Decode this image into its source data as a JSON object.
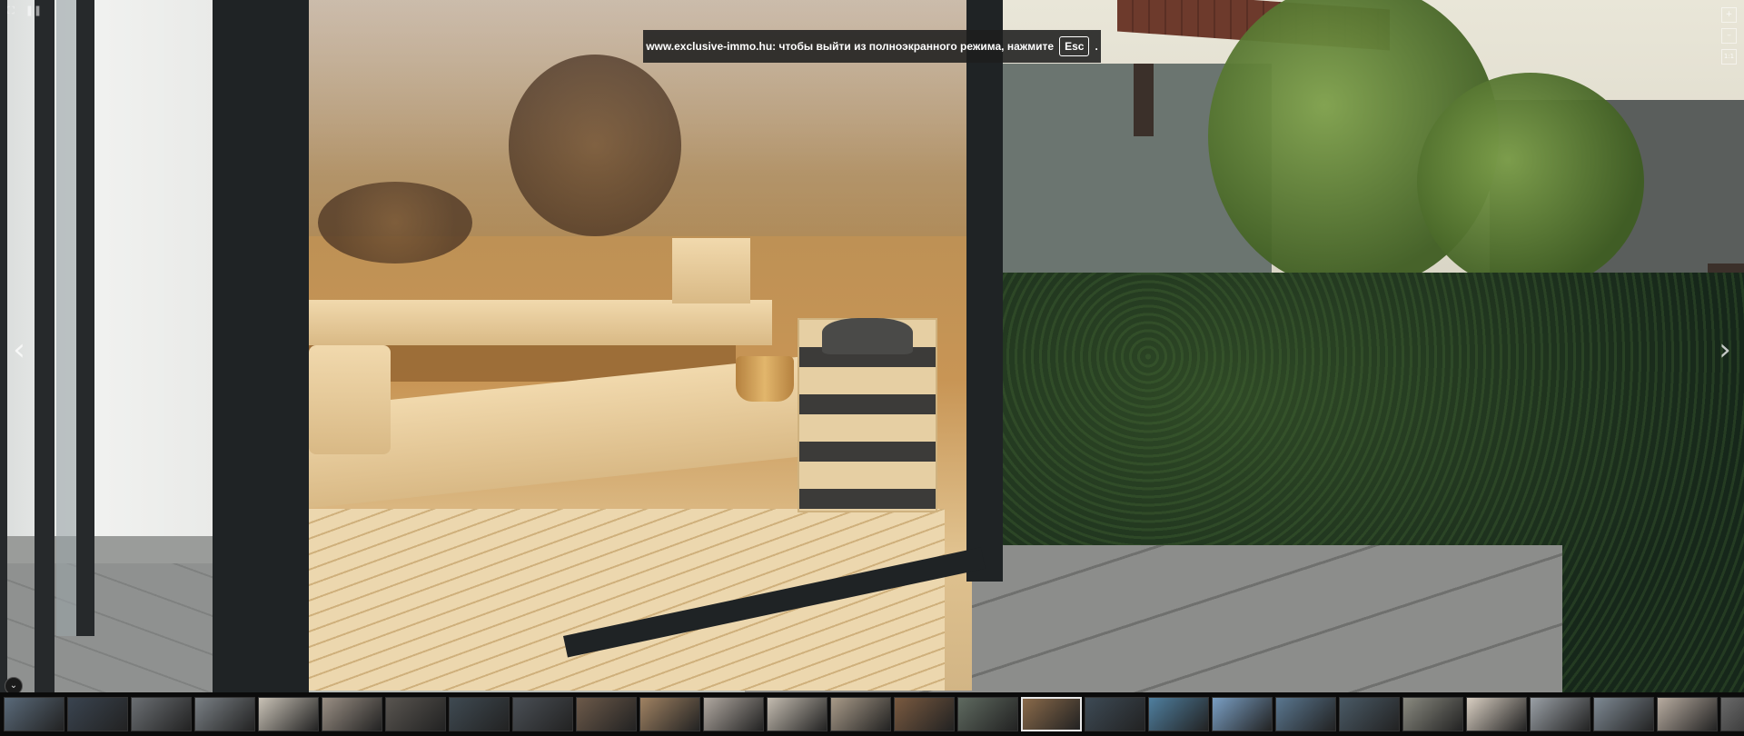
{
  "banner": {
    "text": "www.exclusive-immo.hu: чтобы выйти из полноэкранного режима, нажмите",
    "key": "Esc",
    "suffix": "."
  },
  "nav": {
    "prev_icon": "chevron-left-icon",
    "next_icon": "chevron-right-icon"
  },
  "controls": {
    "zoom_in": "+",
    "zoom_out": "–",
    "ratio": "1:1",
    "collapse_icon": "chevron-down-icon"
  },
  "top_left_icons": [
    "fullscreen-exit-icon",
    "pause-icon"
  ],
  "thumbnails": {
    "count": 28,
    "active_index": 16,
    "colors": [
      "#5a6a7a",
      "#3a4450",
      "#6b6f73",
      "#7a8085",
      "#c9c2b6",
      "#9a8f84",
      "#595550",
      "#3f4a52",
      "#4a4f55",
      "#6d5a4a",
      "#a08262",
      "#b0a8a0",
      "#c4bcb0",
      "#a89a88",
      "#7a5a40",
      "#5f6a60",
      "#8a6a4a",
      "#3d4a55",
      "#4f7f9f",
      "#7a9fc4",
      "#5a7790",
      "#4a5a66",
      "#8a8a80",
      "#d9cfc2",
      "#9aa0a6",
      "#7f8a94",
      "#b8aca0",
      "#6a6a6a"
    ]
  }
}
